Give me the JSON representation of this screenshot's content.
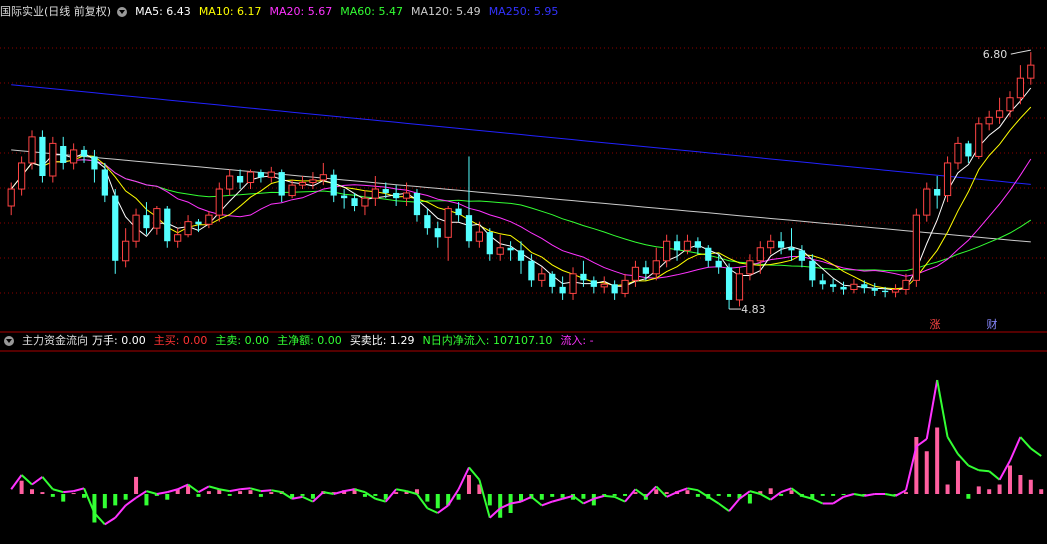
{
  "main_header": {
    "title": "国际实业(日线 前复权)",
    "ma": [
      {
        "label": "MA5: 6.43",
        "color": "#ffffff"
      },
      {
        "label": "MA10: 6.17",
        "color": "#ffff00"
      },
      {
        "label": "MA20: 5.67",
        "color": "#ff33ff"
      },
      {
        "label": "MA60: 5.47",
        "color": "#33ff33"
      },
      {
        "label": "MA120: 5.49",
        "color": "#cccccc"
      },
      {
        "label": "MA250: 5.95",
        "color": "#3333ff"
      }
    ]
  },
  "sub_header": {
    "title": "主力资金流向",
    "items": [
      {
        "label": "万手: 0.00",
        "color": "#ffffff"
      },
      {
        "label": "主买: 0.00",
        "color": "#ff3333"
      },
      {
        "label": "主卖: 0.00",
        "color": "#33ff33"
      },
      {
        "label": "主净额: 0.00",
        "color": "#33ff33"
      },
      {
        "label": "买卖比: 1.29",
        "color": "#ffffff"
      },
      {
        "label": "N日内净流入: 107107.10",
        "color": "#33ff33"
      },
      {
        "label": "流入: -",
        "color": "#ff33ff"
      }
    ]
  },
  "annotations": {
    "high": "6.80",
    "low": "4.83",
    "tag_zhang": "涨",
    "tag_cai": "财"
  },
  "colors": {
    "up": "#ff4444",
    "down": "#54ffff",
    "ma5": "#ffffff",
    "ma10": "#ffff00",
    "ma20": "#ff33ff",
    "ma60": "#33ff33",
    "ma120": "#cccccc",
    "ma250": "#2222ff",
    "grid": "#8b0000"
  },
  "chart_data": {
    "type": "candlestick",
    "note_units": "price (yuan)",
    "ylim": [
      4.7,
      7.0
    ],
    "candles": [
      [
        5.62,
        5.75,
        5.55,
        5.8
      ],
      [
        5.75,
        5.95,
        5.7,
        6.0
      ],
      [
        5.95,
        6.15,
        5.9,
        6.2
      ],
      [
        6.15,
        5.85,
        5.8,
        6.2
      ],
      [
        5.85,
        6.1,
        5.8,
        6.15
      ],
      [
        6.08,
        5.95,
        5.9,
        6.15
      ],
      [
        5.95,
        6.05,
        5.9,
        6.1
      ],
      [
        6.05,
        6.0,
        5.95,
        6.08
      ],
      [
        6.0,
        5.9,
        5.8,
        6.05
      ],
      [
        5.9,
        5.7,
        5.65,
        5.95
      ],
      [
        5.7,
        5.2,
        5.1,
        5.75
      ],
      [
        5.2,
        5.35,
        5.15,
        5.45
      ],
      [
        5.35,
        5.55,
        5.3,
        5.6
      ],
      [
        5.55,
        5.45,
        5.4,
        5.65
      ],
      [
        5.45,
        5.6,
        5.4,
        5.62
      ],
      [
        5.6,
        5.35,
        5.3,
        5.62
      ],
      [
        5.35,
        5.4,
        5.3,
        5.45
      ],
      [
        5.4,
        5.5,
        5.38,
        5.55
      ],
      [
        5.5,
        5.48,
        5.42,
        5.52
      ],
      [
        5.48,
        5.55,
        5.45,
        5.58
      ],
      [
        5.55,
        5.75,
        5.5,
        5.8
      ],
      [
        5.75,
        5.85,
        5.7,
        5.9
      ],
      [
        5.85,
        5.8,
        5.75,
        5.9
      ],
      [
        5.8,
        5.88,
        5.75,
        5.9
      ],
      [
        5.88,
        5.84,
        5.8,
        5.9
      ],
      [
        5.84,
        5.88,
        5.8,
        5.92
      ],
      [
        5.88,
        5.7,
        5.65,
        5.9
      ],
      [
        5.7,
        5.78,
        5.68,
        5.82
      ],
      [
        5.78,
        5.8,
        5.75,
        5.85
      ],
      [
        5.8,
        5.82,
        5.75,
        5.88
      ],
      [
        5.82,
        5.86,
        5.78,
        5.95
      ],
      [
        5.86,
        5.7,
        5.65,
        5.9
      ],
      [
        5.7,
        5.68,
        5.6,
        5.75
      ],
      [
        5.68,
        5.62,
        5.58,
        5.72
      ],
      [
        5.62,
        5.68,
        5.55,
        5.74
      ],
      [
        5.68,
        5.75,
        5.62,
        5.85
      ],
      [
        5.75,
        5.72,
        5.68,
        5.8
      ],
      [
        5.72,
        5.68,
        5.62,
        5.78
      ],
      [
        5.68,
        5.72,
        5.62,
        5.8
      ],
      [
        5.72,
        5.55,
        5.5,
        5.75
      ],
      [
        5.55,
        5.45,
        5.4,
        5.6
      ],
      [
        5.45,
        5.38,
        5.3,
        5.5
      ],
      [
        5.38,
        5.6,
        5.2,
        5.62
      ],
      [
        5.6,
        5.55,
        5.5,
        5.65
      ],
      [
        5.55,
        5.35,
        5.3,
        6.0
      ],
      [
        5.35,
        5.42,
        5.3,
        5.5
      ],
      [
        5.42,
        5.25,
        5.2,
        5.45
      ],
      [
        5.25,
        5.3,
        5.2,
        5.4
      ],
      [
        5.3,
        5.28,
        5.2,
        5.35
      ],
      [
        5.28,
        5.2,
        5.1,
        5.35
      ],
      [
        5.2,
        5.05,
        5.0,
        5.25
      ],
      [
        5.05,
        5.1,
        5.0,
        5.15
      ],
      [
        5.1,
        5.0,
        4.95,
        5.12
      ],
      [
        5.0,
        4.95,
        4.9,
        5.08
      ],
      [
        4.95,
        5.1,
        4.9,
        5.15
      ],
      [
        5.1,
        5.05,
        5.0,
        5.2
      ],
      [
        5.05,
        5.0,
        4.95,
        5.08
      ],
      [
        5.0,
        5.02,
        4.95,
        5.08
      ],
      [
        5.02,
        4.95,
        4.9,
        5.05
      ],
      [
        4.95,
        5.05,
        4.92,
        5.1
      ],
      [
        5.05,
        5.15,
        5.0,
        5.2
      ],
      [
        5.15,
        5.1,
        5.05,
        5.2
      ],
      [
        5.1,
        5.2,
        5.05,
        5.3
      ],
      [
        5.2,
        5.35,
        5.15,
        5.4
      ],
      [
        5.35,
        5.28,
        5.2,
        5.4
      ],
      [
        5.28,
        5.35,
        5.25,
        5.4
      ],
      [
        5.35,
        5.3,
        5.25,
        5.38
      ],
      [
        5.3,
        5.2,
        5.15,
        5.32
      ],
      [
        5.2,
        5.15,
        5.1,
        5.25
      ],
      [
        5.15,
        4.9,
        4.83,
        5.18
      ],
      [
        4.9,
        5.1,
        4.85,
        5.15
      ],
      [
        5.1,
        5.2,
        5.05,
        5.25
      ],
      [
        5.2,
        5.3,
        5.1,
        5.35
      ],
      [
        5.3,
        5.35,
        5.25,
        5.4
      ],
      [
        5.35,
        5.3,
        5.25,
        5.42
      ],
      [
        5.3,
        5.28,
        5.2,
        5.45
      ],
      [
        5.28,
        5.2,
        5.15,
        5.32
      ],
      [
        5.2,
        5.05,
        5.0,
        5.25
      ],
      [
        5.05,
        5.02,
        4.98,
        5.1
      ],
      [
        5.02,
        5.0,
        4.96,
        5.06
      ],
      [
        5.0,
        4.98,
        4.94,
        5.04
      ],
      [
        4.98,
        5.02,
        4.95,
        5.06
      ],
      [
        5.02,
        4.99,
        4.95,
        5.05
      ],
      [
        4.99,
        4.97,
        4.93,
        5.03
      ],
      [
        4.97,
        4.96,
        4.92,
        5.0
      ],
      [
        4.96,
        4.98,
        4.92,
        5.02
      ],
      [
        4.98,
        5.05,
        4.94,
        5.1
      ],
      [
        5.05,
        5.55,
        5.0,
        5.6
      ],
      [
        5.55,
        5.75,
        5.5,
        5.8
      ],
      [
        5.75,
        5.7,
        5.6,
        5.85
      ],
      [
        5.7,
        5.95,
        5.65,
        6.0
      ],
      [
        5.95,
        6.1,
        5.9,
        6.15
      ],
      [
        6.1,
        6.0,
        5.95,
        6.12
      ],
      [
        6.0,
        6.25,
        5.98,
        6.3
      ],
      [
        6.25,
        6.3,
        6.2,
        6.35
      ],
      [
        6.3,
        6.35,
        6.25,
        6.45
      ],
      [
        6.35,
        6.45,
        6.3,
        6.5
      ],
      [
        6.45,
        6.6,
        6.4,
        6.7
      ],
      [
        6.6,
        6.7,
        6.55,
        6.8
      ]
    ],
    "flow": {
      "line": [
        5,
        20,
        10,
        18,
        5,
        2,
        3,
        6,
        -20,
        -32,
        -25,
        -12,
        -4,
        3,
        0,
        2,
        5,
        10,
        2,
        8,
        5,
        3,
        5,
        6,
        3,
        4,
        2,
        -5,
        -3,
        -8,
        2,
        0,
        3,
        5,
        2,
        -5,
        -8,
        5,
        3,
        0,
        -15,
        -20,
        -12,
        5,
        28,
        15,
        -25,
        -15,
        -10,
        -8,
        -3,
        -12,
        -8,
        -5,
        -2,
        -10,
        -5,
        -2,
        -3,
        -8,
        5,
        -3,
        8,
        -3,
        2,
        6,
        4,
        -3,
        -10,
        -18,
        -5,
        3,
        0,
        -6,
        2,
        6,
        -2,
        -5,
        -10,
        -10,
        -3,
        0,
        -2,
        0,
        0,
        -2,
        4,
        50,
        58,
        120,
        60,
        42,
        30,
        25,
        24,
        15,
        35,
        60,
        48,
        40
      ],
      "bars": [
        0,
        14,
        5,
        2,
        -3,
        -8,
        1,
        -4,
        -30,
        -15,
        -12,
        -6,
        18,
        -12,
        -2,
        -6,
        5,
        10,
        -3,
        3,
        5,
        -2,
        3,
        4,
        -3,
        2,
        3,
        -5,
        -2,
        -5,
        3,
        2,
        4,
        6,
        -3,
        -2,
        -6,
        2,
        3,
        5,
        -8,
        -15,
        -12,
        -6,
        20,
        10,
        -12,
        -25,
        -20,
        -8,
        -5,
        -6,
        -3,
        -4,
        -6,
        -5,
        -12,
        -3,
        -2,
        -2,
        2,
        -6,
        5,
        2,
        3,
        4,
        -3,
        -5,
        -2,
        -3,
        -5,
        -10,
        3,
        6,
        -2,
        4,
        -3,
        -5,
        -2,
        -2,
        -1,
        -1,
        -2,
        -1,
        -1,
        -1,
        2,
        60,
        45,
        70,
        10,
        35,
        -5,
        8,
        5,
        10,
        30,
        20,
        15,
        5
      ]
    }
  }
}
